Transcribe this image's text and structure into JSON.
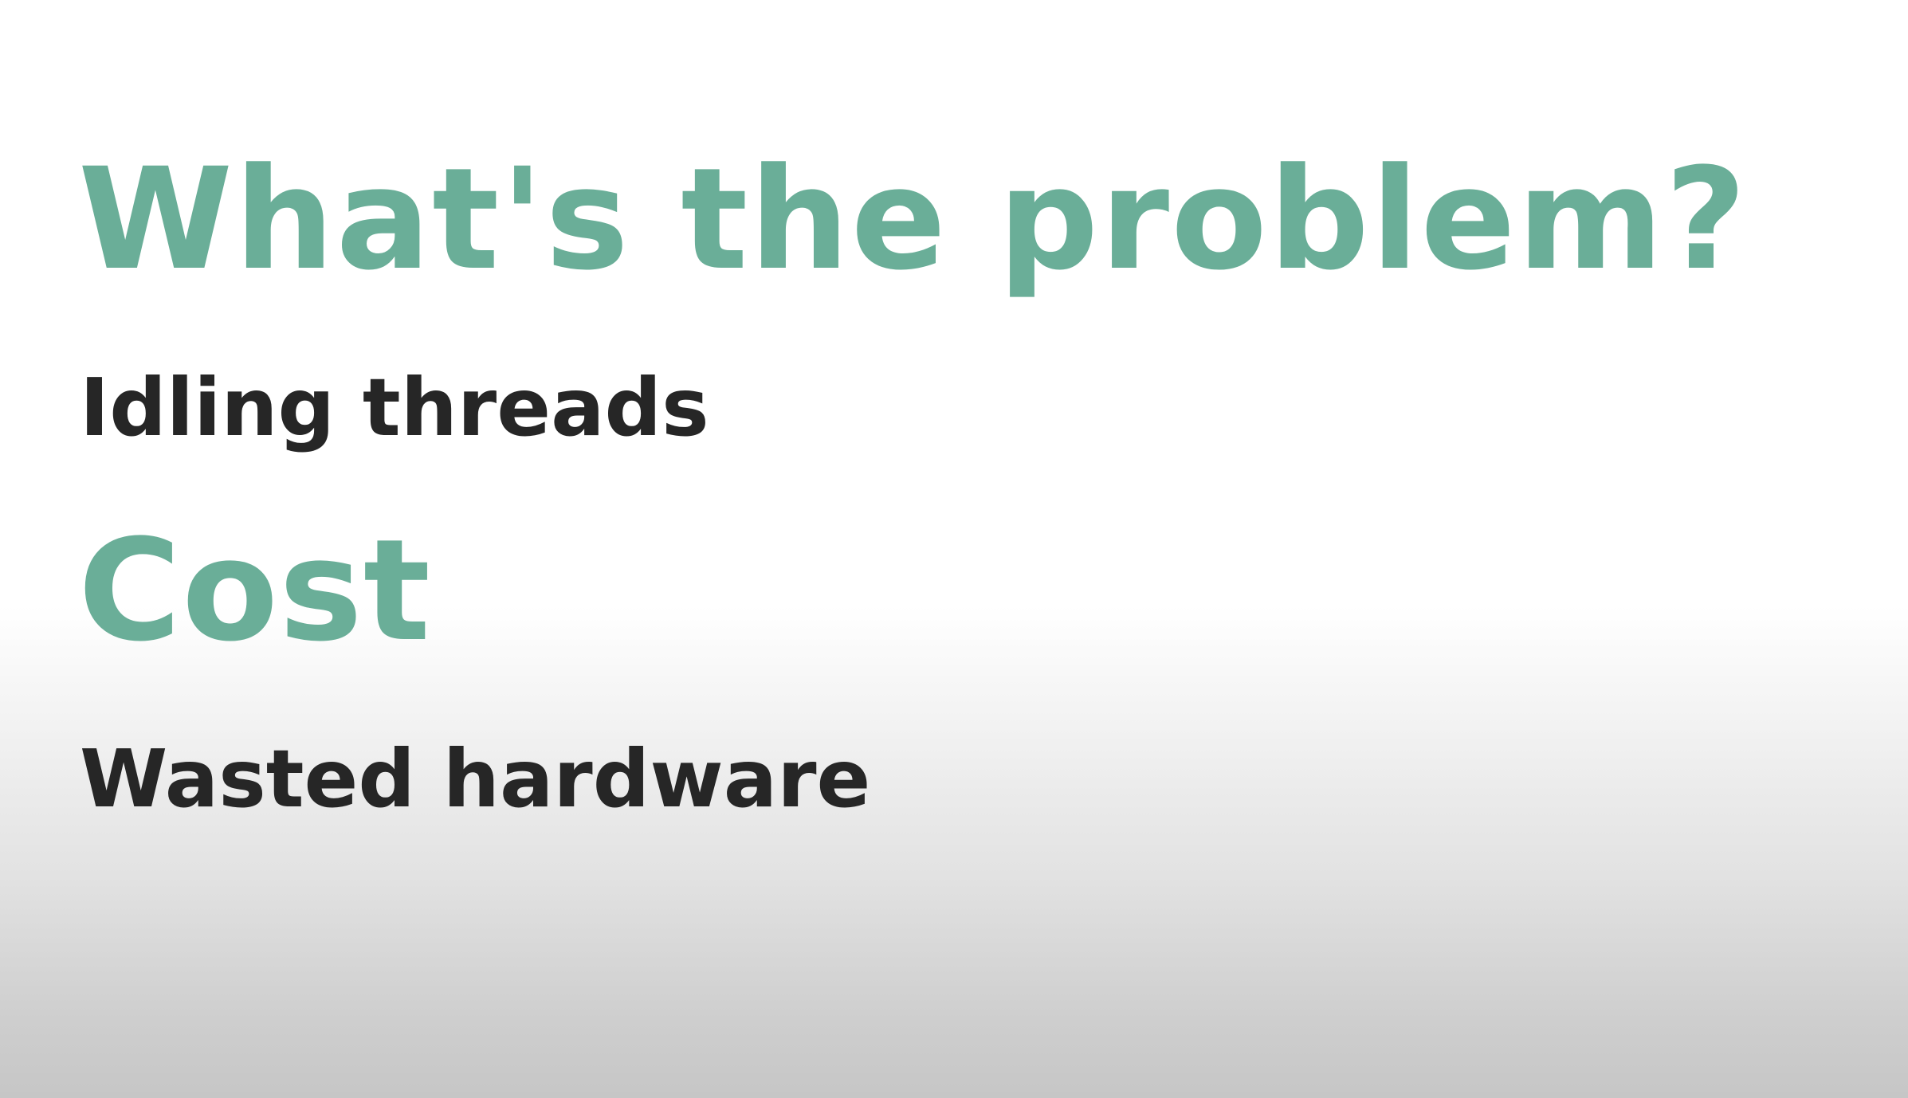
{
  "slide": {
    "title": "What's the problem?",
    "points": [
      {
        "heading": null,
        "text": "Idling threads"
      },
      {
        "heading": "Cost",
        "text": "Wasted hardware"
      }
    ]
  },
  "colors": {
    "heading": "#6aae98",
    "body_text": "#262626",
    "background_top": "#ffffff",
    "background_bottom": "#c6c6c6"
  }
}
